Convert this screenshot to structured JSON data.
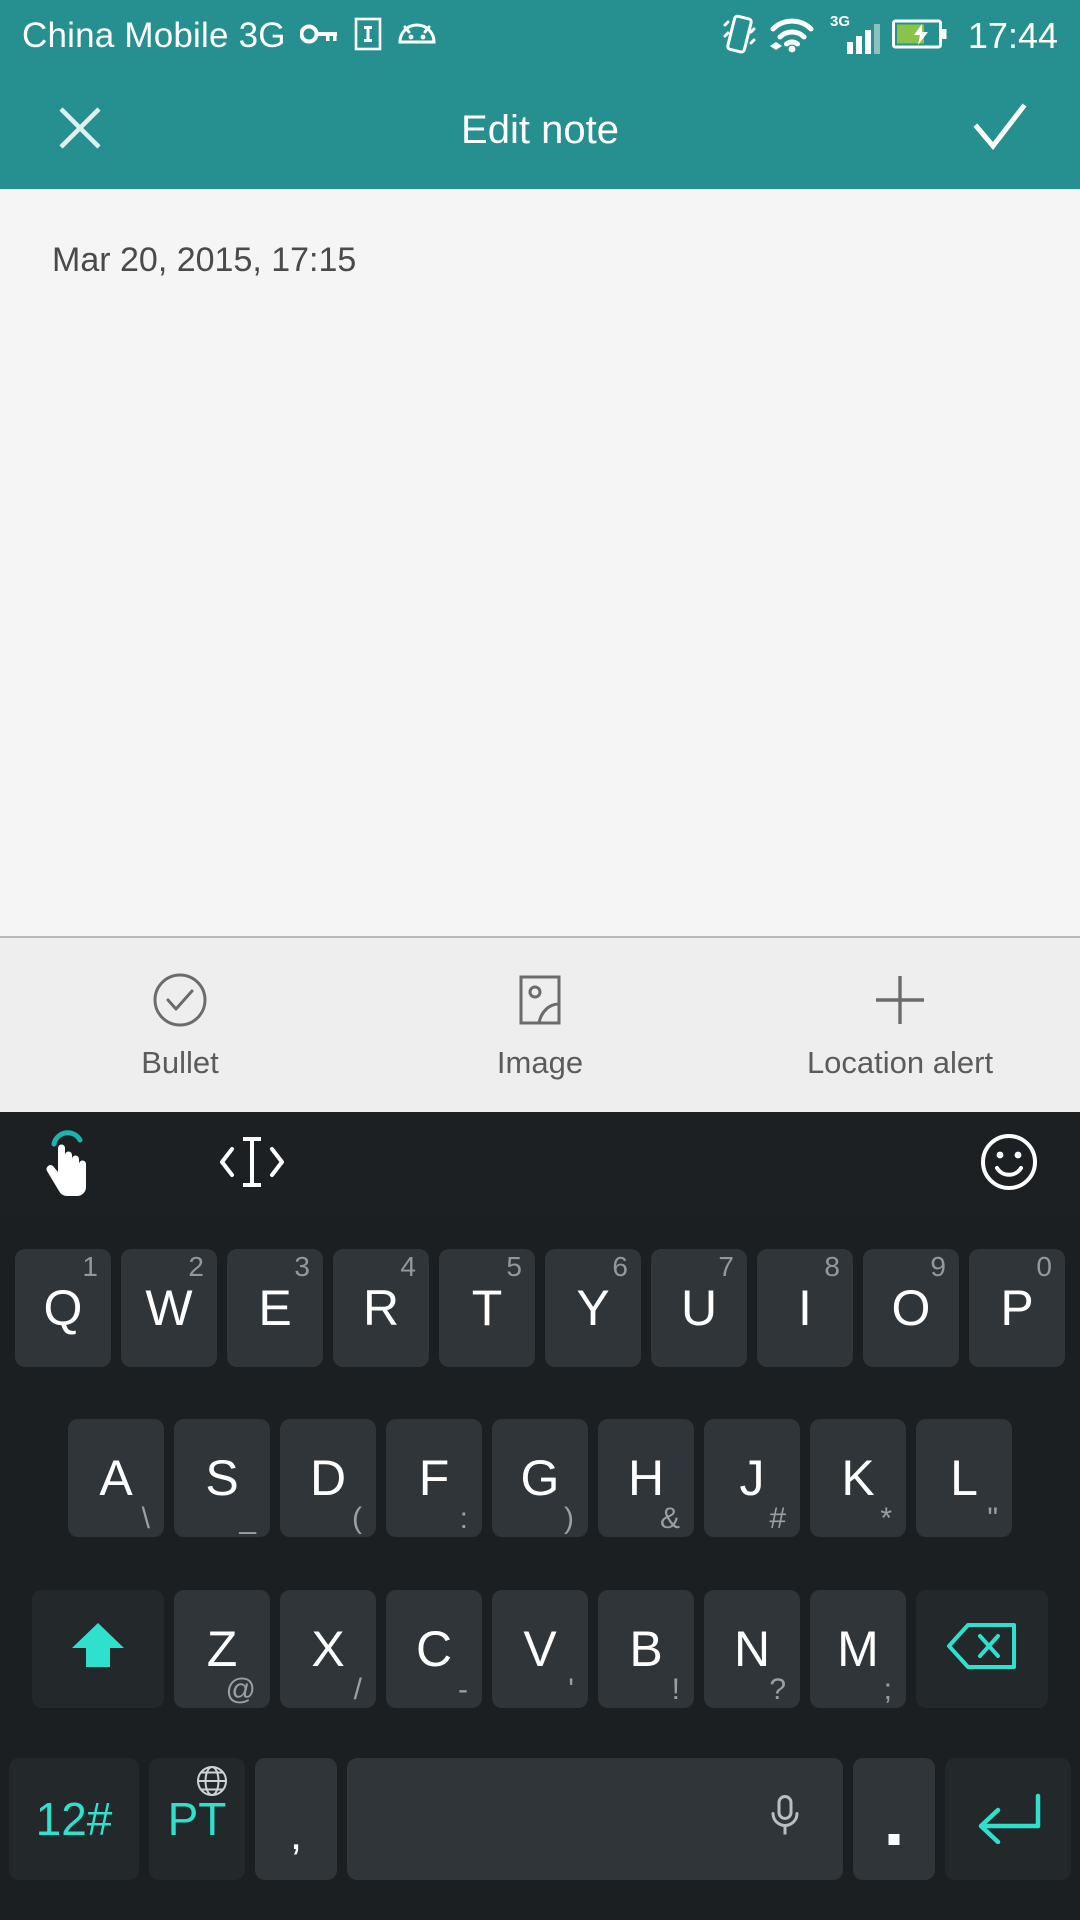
{
  "status_bar": {
    "carrier": "China Mobile 3G",
    "clock": "17:44",
    "network_label": "3G",
    "icons": [
      "key-icon",
      "sim-card-icon",
      "android-icon",
      "vibrate-icon",
      "wifi-icon",
      "signal-icon",
      "battery-charging-icon"
    ]
  },
  "app_bar": {
    "title": "Edit note",
    "close_icon": "close-icon",
    "save_icon": "check-icon"
  },
  "note": {
    "date": "Mar 20, 2015, 17:15",
    "text": "",
    "placeholder": ""
  },
  "note_toolbar": {
    "items": [
      {
        "label": "Bullet",
        "icon": "check-circle-icon"
      },
      {
        "label": "Image",
        "icon": "image-icon"
      },
      {
        "label": "Location alert",
        "icon": "plus-icon"
      }
    ]
  },
  "keyboard": {
    "toolbar": {
      "gesture_icon": "hand-gesture-icon",
      "cursor_icon": "cursor-move-icon",
      "emoji_icon": "smiley-icon"
    },
    "rows": {
      "row1": [
        {
          "main": "Q",
          "sup": "1"
        },
        {
          "main": "W",
          "sup": "2"
        },
        {
          "main": "E",
          "sup": "3"
        },
        {
          "main": "R",
          "sup": "4"
        },
        {
          "main": "T",
          "sup": "5"
        },
        {
          "main": "Y",
          "sup": "6"
        },
        {
          "main": "U",
          "sup": "7"
        },
        {
          "main": "I",
          "sup": "8"
        },
        {
          "main": "O",
          "sup": "9"
        },
        {
          "main": "P",
          "sup": "0"
        }
      ],
      "row2": [
        {
          "main": "A",
          "sub": "\\"
        },
        {
          "main": "S",
          "sub": "_"
        },
        {
          "main": "D",
          "sub": "("
        },
        {
          "main": "F",
          "sub": ":"
        },
        {
          "main": "G",
          "sub": ")"
        },
        {
          "main": "H",
          "sub": "&"
        },
        {
          "main": "J",
          "sub": "#"
        },
        {
          "main": "K",
          "sub": "*"
        },
        {
          "main": "L",
          "sub": "\""
        }
      ],
      "row3": [
        {
          "main": "Z",
          "sub": "@"
        },
        {
          "main": "X",
          "sub": "/"
        },
        {
          "main": "C",
          "sub": "-"
        },
        {
          "main": "V",
          "sub": "'"
        },
        {
          "main": "B",
          "sub": "!"
        },
        {
          "main": "N",
          "sub": "?"
        },
        {
          "main": "M",
          "sub": ";"
        }
      ],
      "shift_icon": "shift-arrow-icon",
      "backspace_icon": "backspace-icon",
      "row4": {
        "symbols_label": "12#",
        "language_label": "PT",
        "language_icon": "globe-icon",
        "comma_label": ",",
        "space_icon": "microphone-icon",
        "period_label": ".",
        "enter_icon": "enter-arrow-icon"
      }
    }
  },
  "colors": {
    "accent_teal": "#269090",
    "key_accent": "#2fe0cd",
    "note_bg": "#f5f5f5",
    "toolbar_bg": "#eeeeee",
    "keyboard_bg": "#1c1f21"
  }
}
